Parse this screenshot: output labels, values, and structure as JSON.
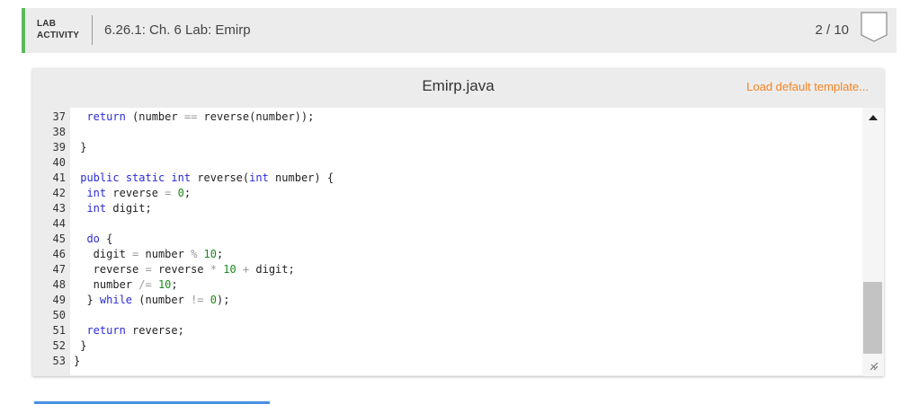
{
  "header": {
    "tag_line1": "LAB",
    "tag_line2": "ACTIVITY",
    "title": "6.26.1: Ch. 6 Lab: Emirp",
    "score": "2 / 10",
    "accent_color": "#5cb85c",
    "badge_icon": "shield-badge-icon"
  },
  "editor": {
    "filename": "Emirp.java",
    "load_template": "Load default template...",
    "load_template_color": "#f58320",
    "lines": [
      {
        "n": "37",
        "html": "  <span class=\"kw\">return</span> (number <span class=\"op\">==</span> reverse(number));"
      },
      {
        "n": "38",
        "html": ""
      },
      {
        "n": "39",
        "html": " }"
      },
      {
        "n": "40",
        "html": ""
      },
      {
        "n": "41",
        "html": " <span class=\"kw\">public</span> <span class=\"kw\">static</span> <span class=\"kw\">int</span> reverse(<span class=\"kw\">int</span> number) {"
      },
      {
        "n": "42",
        "html": "  <span class=\"kw\">int</span> reverse <span class=\"op\">=</span> <span class=\"num\">0</span>;"
      },
      {
        "n": "43",
        "html": "  <span class=\"kw\">int</span> digit;"
      },
      {
        "n": "44",
        "html": ""
      },
      {
        "n": "45",
        "html": "  <span class=\"kw\">do</span> {"
      },
      {
        "n": "46",
        "html": "   digit <span class=\"op\">=</span> number <span class=\"op\">%</span> <span class=\"num\">10</span>;"
      },
      {
        "n": "47",
        "html": "   reverse <span class=\"op\">=</span> reverse <span class=\"op\">*</span> <span class=\"num\">10</span> <span class=\"op\">+</span> digit;"
      },
      {
        "n": "48",
        "html": "   number <span class=\"op\">/=</span> <span class=\"num\">10</span>;"
      },
      {
        "n": "49",
        "html": "  } <span class=\"kw\">while</span> (number <span class=\"op\">!=</span> <span class=\"num\">0</span>);"
      },
      {
        "n": "50",
        "html": ""
      },
      {
        "n": "51",
        "html": "  <span class=\"kw\">return</span> reverse;"
      },
      {
        "n": "52",
        "html": " }"
      },
      {
        "n": "53",
        "html": "}"
      }
    ]
  },
  "scrollbar": {
    "up_icon": "scroll-up-arrow-icon",
    "resize_icon": "resize-grip-icon"
  }
}
